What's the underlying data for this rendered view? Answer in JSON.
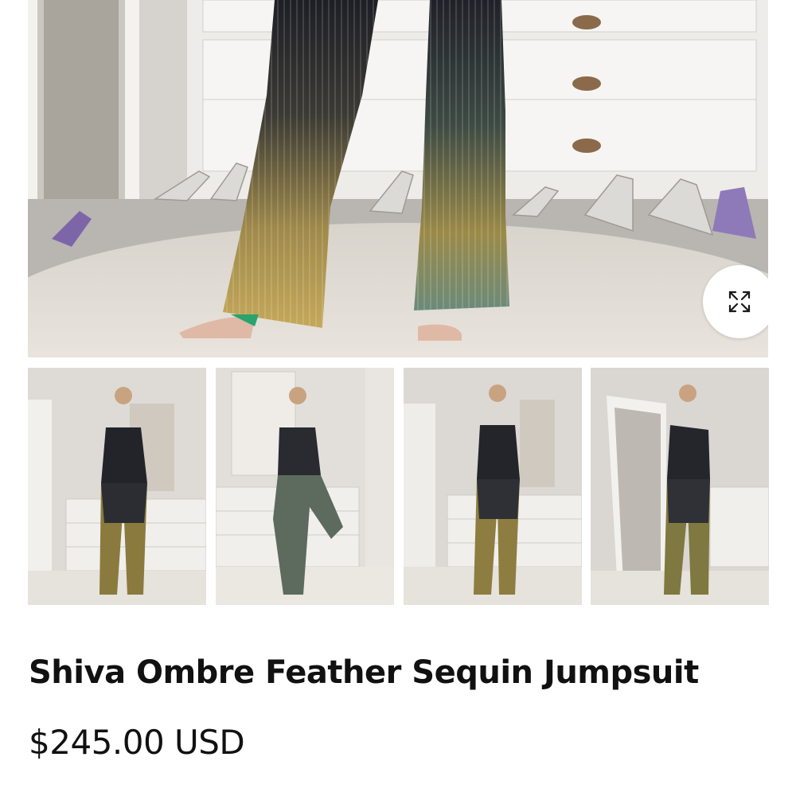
{
  "gallery": {
    "main_image_alt": "",
    "zoom_icon": "expand-arrows-icon",
    "thumbnails": [
      {
        "alt": ""
      },
      {
        "alt": ""
      },
      {
        "alt": ""
      },
      {
        "alt": ""
      }
    ]
  },
  "product": {
    "title": "Shiva Ombre Feather Sequin Jumpsuit",
    "price": "$245.00 USD"
  },
  "colors": {
    "text": "#111111",
    "background": "#ffffff",
    "sequin_gold": "#b89a4a",
    "sequin_dark": "#22232a"
  }
}
